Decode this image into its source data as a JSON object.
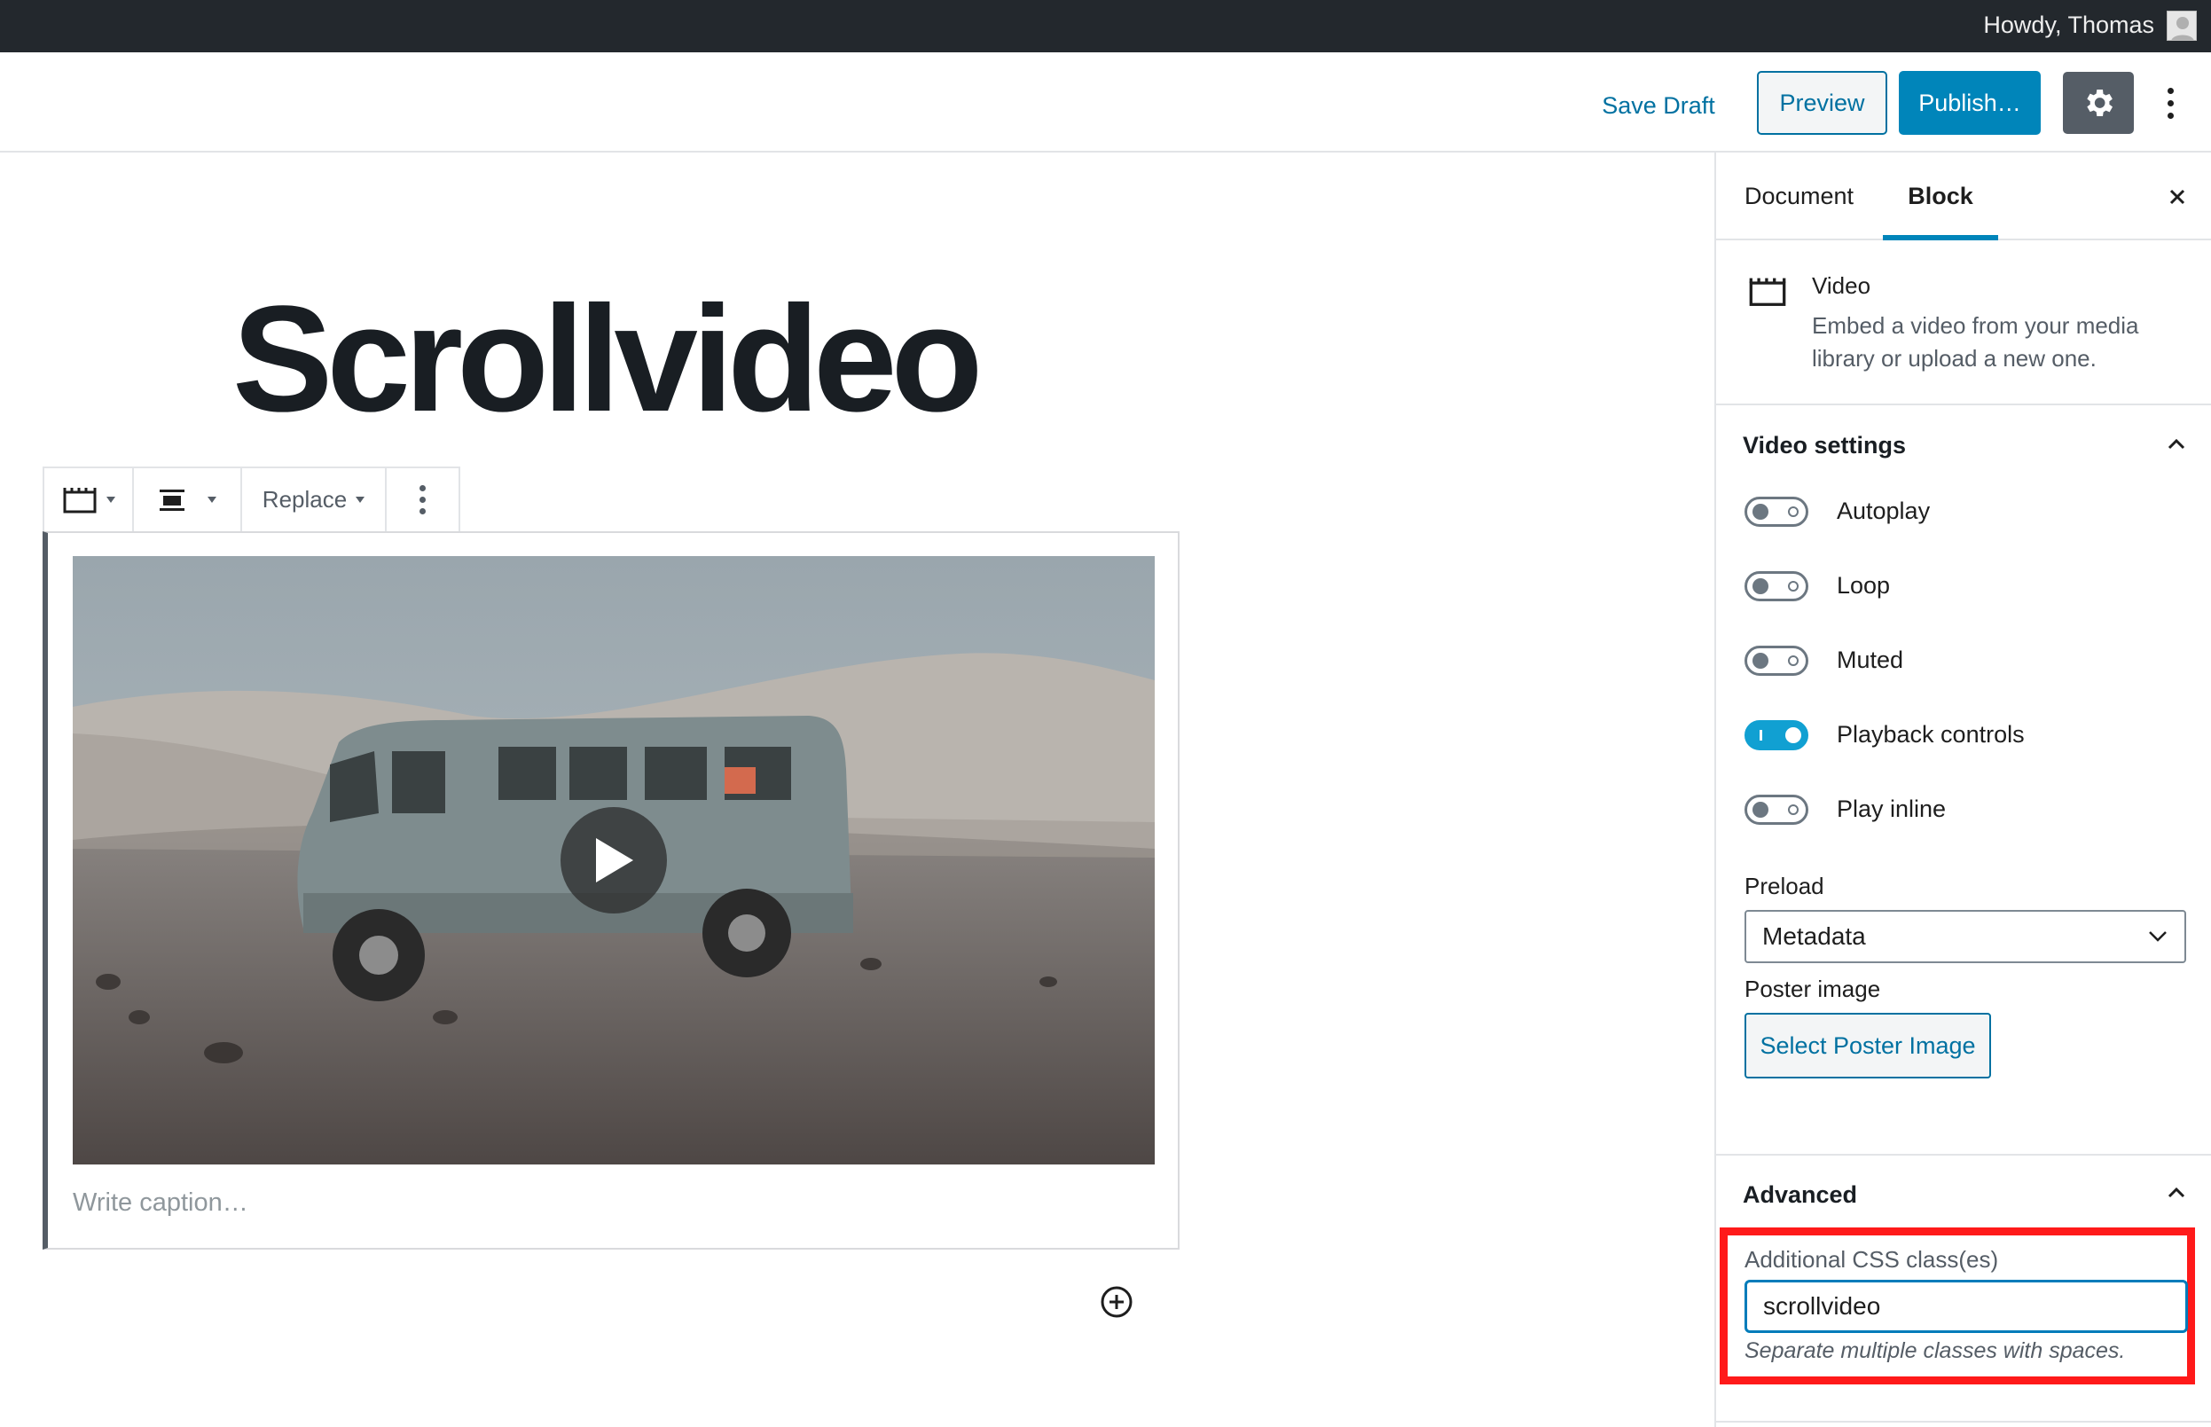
{
  "admin_bar": {
    "greeting": "Howdy, Thomas"
  },
  "header": {
    "save_draft": "Save Draft",
    "preview": "Preview",
    "publish": "Publish…"
  },
  "editor": {
    "title": "Scrollvideo",
    "toolbar": {
      "replace": "Replace"
    },
    "caption_placeholder": "Write caption…"
  },
  "sidebar": {
    "tabs": [
      "Document",
      "Block"
    ],
    "active_tab": "Block",
    "block_card": {
      "title": "Video",
      "description": "Embed a video from your media library or upload a new one."
    },
    "video_settings": {
      "title": "Video settings",
      "toggles": [
        {
          "label": "Autoplay",
          "on": false
        },
        {
          "label": "Loop",
          "on": false
        },
        {
          "label": "Muted",
          "on": false
        },
        {
          "label": "Playback controls",
          "on": true
        },
        {
          "label": "Play inline",
          "on": false
        }
      ],
      "preload_label": "Preload",
      "preload_value": "Metadata",
      "poster_label": "Poster image",
      "poster_button": "Select Poster Image"
    },
    "advanced": {
      "title": "Advanced",
      "css_label": "Additional CSS class(es)",
      "css_value": "scrollvideo",
      "css_help": "Separate multiple classes with spaces."
    }
  },
  "colors": {
    "accent": "#0085ba",
    "link": "#0071a1",
    "highlight": "#ff1a1a",
    "admin_bar": "#23282d"
  }
}
